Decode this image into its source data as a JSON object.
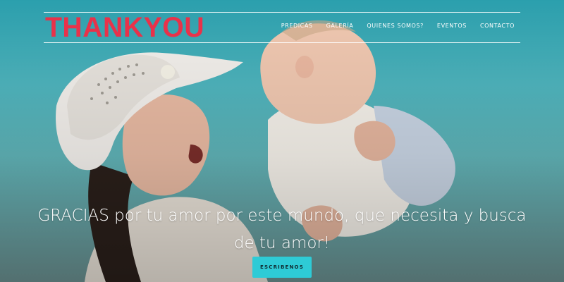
{
  "brand": {
    "logo_text": "THANKYOU",
    "logo_color": "#e8324a"
  },
  "nav": {
    "items": [
      {
        "label": "PREDICAS"
      },
      {
        "label": "GALERÍA"
      },
      {
        "label": "QUIENES SOMOS?"
      },
      {
        "label": "EVENTOS"
      },
      {
        "label": "CONTACTO"
      }
    ]
  },
  "hero": {
    "headline": "GRACIAS por tu amor por este mundo, que necesita y busca de tu amor!",
    "cta_label": "ESCRIBENOS",
    "cta_color": "#2ecbd6"
  }
}
